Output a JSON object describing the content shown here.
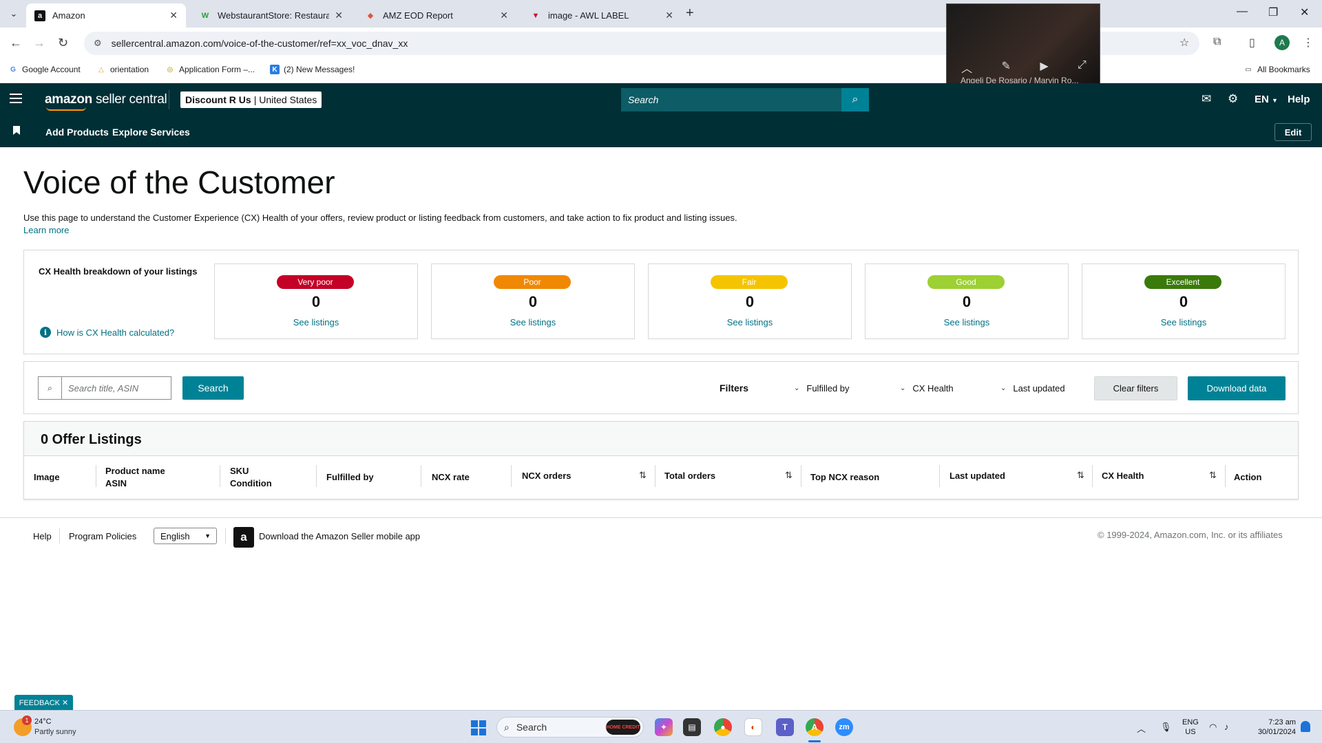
{
  "browser": {
    "tabs": [
      {
        "title": "Amazon",
        "favicon": "a",
        "active": true
      },
      {
        "title": "WebstaurantStore: Restaurant S",
        "favicon": "W",
        "active": false
      },
      {
        "title": "AMZ EOD Report",
        "favicon": "◆",
        "active": false
      },
      {
        "title": "image - AWL LABEL",
        "favicon": "▼",
        "active": false
      }
    ],
    "url": "sellercentral.amazon.com/voice-of-the-customer/ref=xx_voc_dnav_xx",
    "profile_initial": "A",
    "bookmarks": [
      {
        "label": "Google Account",
        "icon": "G"
      },
      {
        "label": "orientation",
        "icon": "△"
      },
      {
        "label": "Application Form –...",
        "icon": "◎"
      },
      {
        "label": "(2) New Messages!",
        "icon": "K"
      }
    ],
    "all_bookmarks": "All Bookmarks"
  },
  "video_call": {
    "participants": "Angeli De Rosario / Marvin Ro..."
  },
  "header": {
    "logo_brand": "amazon",
    "logo_suffix": "seller central",
    "store_name": "Discount R Us",
    "store_region": "United States",
    "search_placeholder": "Search",
    "language": "EN",
    "help": "Help"
  },
  "subnav": {
    "links": [
      "Add Products",
      "Explore Services"
    ],
    "edit": "Edit"
  },
  "page": {
    "title": "Voice of the Customer",
    "description": "Use this page to understand the Customer Experience (CX) Health of your offers, review product or listing feedback from customers, and take action to fix product and listing issues.",
    "learn_more": "Learn more"
  },
  "cx_health": {
    "title": "CX Health breakdown of your listings",
    "help_link": "How is CX Health calculated?",
    "cards": [
      {
        "label": "Very poor",
        "count": "0",
        "link": "See listings",
        "color": "#c40027",
        "text_color": "#ffffff"
      },
      {
        "label": "Poor",
        "count": "0",
        "link": "See listings",
        "color": "#f08804",
        "text_color": "#ffffff"
      },
      {
        "label": "Fair",
        "count": "0",
        "link": "See listings",
        "color": "#f5c400",
        "text_color": "#ffffff"
      },
      {
        "label": "Good",
        "count": "0",
        "link": "See listings",
        "color": "#9dd033",
        "text_color": "#ffffff"
      },
      {
        "label": "Excellent",
        "count": "0",
        "link": "See listings",
        "color": "#3a7a0a",
        "text_color": "#ffffff"
      }
    ]
  },
  "filters": {
    "search_placeholder": "Search title, ASIN",
    "search_button": "Search",
    "label": "Filters",
    "dropdowns": [
      "Fulfilled by",
      "CX Health",
      "Last updated"
    ],
    "clear": "Clear filters",
    "download": "Download data"
  },
  "listings": {
    "title": "0 Offer Listings",
    "columns": [
      {
        "line1": "Image",
        "line2": ""
      },
      {
        "line1": "Product name",
        "line2": "ASIN"
      },
      {
        "line1": "SKU",
        "line2": "Condition"
      },
      {
        "line1": "Fulfilled by",
        "line2": ""
      },
      {
        "line1": "NCX rate",
        "line2": ""
      },
      {
        "line1": "NCX orders",
        "line2": ""
      },
      {
        "line1": "Total orders",
        "line2": ""
      },
      {
        "line1": "Top NCX reason",
        "line2": ""
      },
      {
        "line1": "Last updated",
        "line2": ""
      },
      {
        "line1": "CX Health",
        "line2": ""
      },
      {
        "line1": "Action",
        "line2": ""
      }
    ]
  },
  "footer": {
    "help": "Help",
    "policies": "Program Policies",
    "language": "English",
    "app_link": "Download the Amazon Seller mobile app",
    "copyright": "© 1999-2024, Amazon.com, Inc. or its affiliates"
  },
  "feedback": "FEEDBACK ✕",
  "taskbar": {
    "weather_temp": "24°C",
    "weather_desc": "Partly sunny",
    "weather_badge": "1",
    "search": "Search",
    "search_badge": "HOME CREDIT",
    "lang_line1": "ENG",
    "lang_line2": "US",
    "time": "7:23 am",
    "date": "30/01/2024"
  },
  "colors": {
    "header_bg": "#002f36",
    "accent": "#008296",
    "link": "#007185"
  }
}
